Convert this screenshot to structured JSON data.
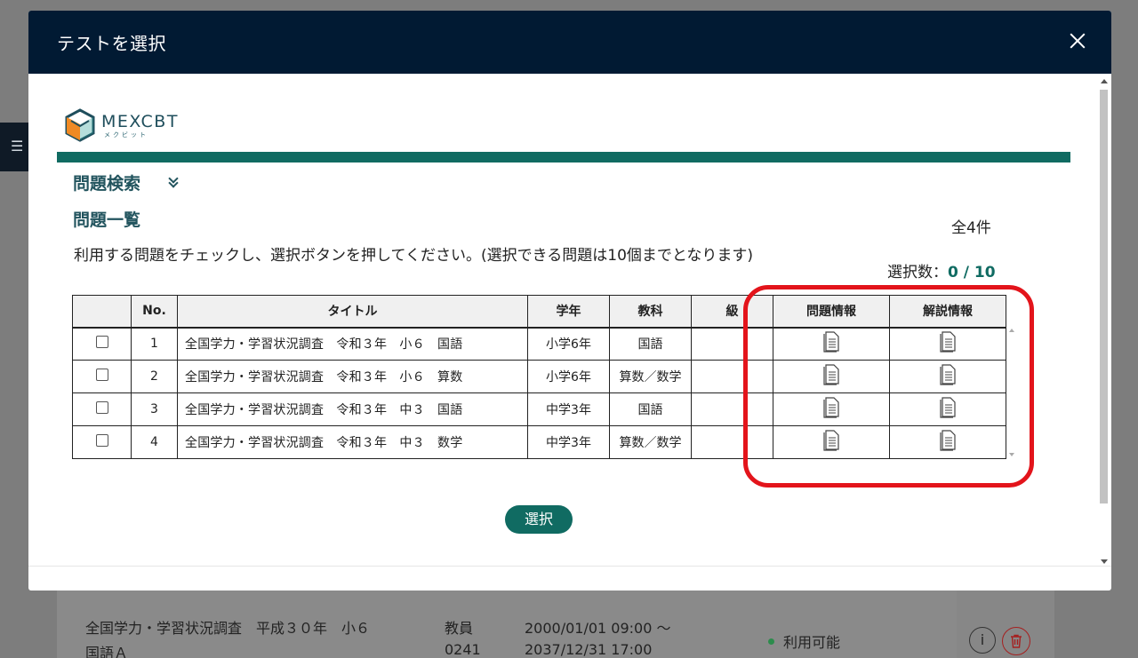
{
  "background": {
    "row_title_line1": "全国学力・学習状況調査　平成３０年　小６",
    "row_title_line2": "国語Ａ",
    "row_author": "教員",
    "row_id": "0241",
    "row_period_start": "2000/01/01 09:00 〜",
    "row_period_end": "2037/12/31 17:00",
    "row_status": "利用可能",
    "info_label": "i",
    "delete_icon": "trash-icon"
  },
  "modal": {
    "title": "テストを選択",
    "close_icon": "close-icon"
  },
  "logo": {
    "main": "MEXCBT",
    "sub": "メクビット"
  },
  "search_section": {
    "title": "問題検索"
  },
  "list_section": {
    "title": "問題一覧",
    "total": "全4件",
    "instructions": "利用する問題をチェックし、選択ボタンを押してください。(選択できる問題は10個までとなります)",
    "selected_label": "選択数：",
    "selected_count": "0",
    "selected_sep": " / ",
    "selected_max": "10"
  },
  "table": {
    "headers": {
      "check": "",
      "no": "No.",
      "title": "タイトル",
      "grade": "学年",
      "subject": "教科",
      "level": "級",
      "question_info": "問題情報",
      "answer_info": "解説情報"
    },
    "rows": [
      {
        "no": "1",
        "title": "全国学力・学習状況調査　令和３年　小６　国語",
        "grade": "小学6年",
        "subject": "国語",
        "level": ""
      },
      {
        "no": "2",
        "title": "全国学力・学習状況調査　令和３年　小６　算数",
        "grade": "小学6年",
        "subject": "算数／数学",
        "level": ""
      },
      {
        "no": "3",
        "title": "全国学力・学習状況調査　令和３年　中３　国語",
        "grade": "中学3年",
        "subject": "国語",
        "level": ""
      },
      {
        "no": "4",
        "title": "全国学力・学習状況調査　令和３年　中３　数学",
        "grade": "中学3年",
        "subject": "算数／数学",
        "level": ""
      }
    ]
  },
  "select_button": {
    "label": "選択"
  },
  "colors": {
    "header_bg": "#011a33",
    "accent": "#106b62",
    "highlight": "#e3141b"
  }
}
